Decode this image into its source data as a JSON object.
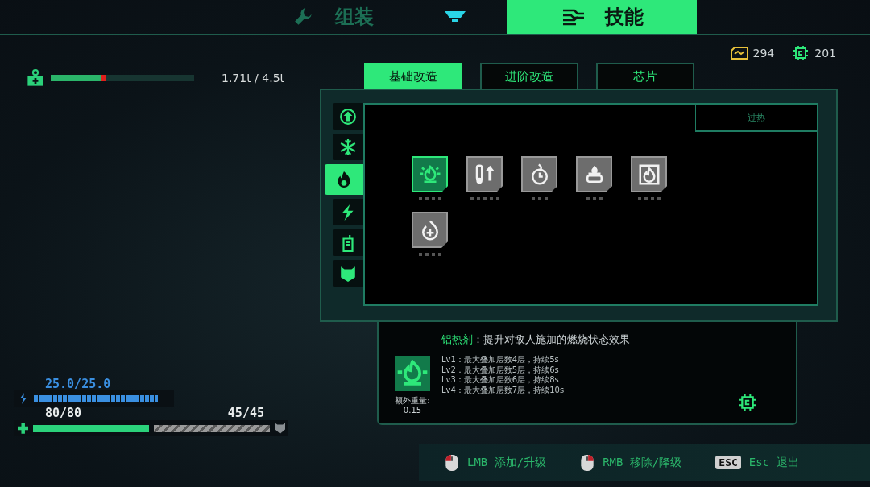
{
  "main_tabs": [
    {
      "label": "组装",
      "selected": false
    },
    {
      "label": "技能",
      "selected": true
    }
  ],
  "currencies": [
    {
      "value": "294",
      "color": "#e8c13a"
    },
    {
      "value": "201",
      "color": "#2ee87a"
    }
  ],
  "weight": {
    "level": 0.39,
    "reading": "1.71t / 4.5t"
  },
  "sub_tabs": [
    {
      "label": "基础改造",
      "selected": true
    },
    {
      "label": "进阶改造",
      "selected": false
    },
    {
      "label": "芯片",
      "selected": false
    }
  ],
  "categories": [
    {
      "selected": false
    },
    {
      "selected": false
    },
    {
      "selected": true
    },
    {
      "selected": false
    },
    {
      "selected": false
    },
    {
      "selected": false
    }
  ],
  "panel_label": "过热",
  "skills": [
    {
      "selected": true,
      "pips": [
        false,
        false,
        false,
        false
      ]
    },
    {
      "selected": false,
      "pips": [
        false,
        false,
        false,
        false,
        false
      ]
    },
    {
      "selected": false,
      "pips": [
        false,
        false,
        false
      ]
    },
    {
      "selected": false,
      "pips": [
        false,
        false,
        false
      ]
    },
    {
      "selected": false,
      "pips": [
        false,
        false,
        false,
        false
      ]
    },
    {
      "selected": false,
      "pips": [
        false,
        false,
        false,
        false
      ]
    }
  ],
  "detail": {
    "name": "铝热剂",
    "description": "：提升对敌人施加的燃烧状态效果",
    "extra_weight_label": "额外重量:",
    "extra_weight": "0.15",
    "levels": [
      "Lv1：最大叠加层数4层，持续5s",
      "Lv2：最大叠加层数5层，持续6s",
      "Lv3：最大叠加层数6层，持续8s",
      "Lv4：最大叠加层数7层，持续10s"
    ]
  },
  "energy": {
    "reading": "25.0/25.0",
    "level": 1
  },
  "health": {
    "reading": "80/80",
    "level": 1
  },
  "armor": {
    "reading": "45/45",
    "level": 1
  },
  "hints": [
    {
      "kind": "mouse-left",
      "text": "LMB 添加/升级"
    },
    {
      "kind": "mouse-right",
      "text": "RMB 移除/降级"
    },
    {
      "kind": "key",
      "key": "ESC",
      "text": "Esc 退出"
    }
  ]
}
